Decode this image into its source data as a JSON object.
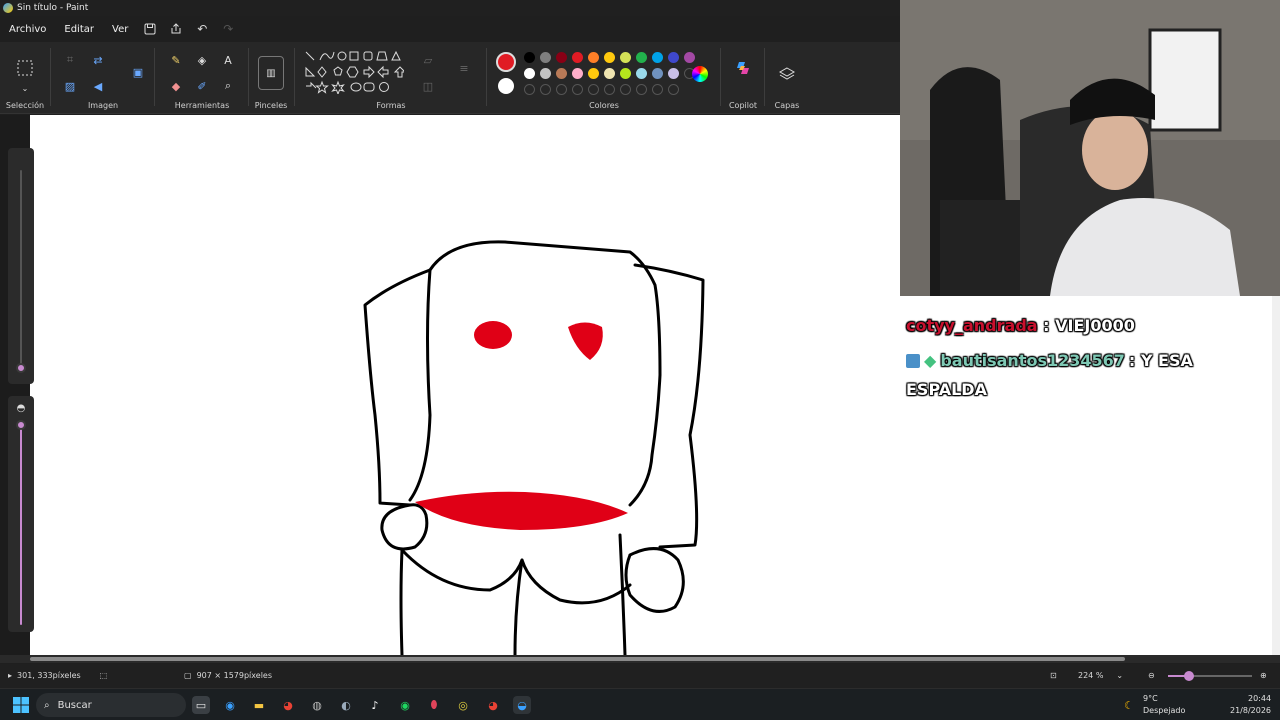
{
  "window": {
    "title": "Sin título - Paint"
  },
  "menu": {
    "file": "Archivo",
    "edit": "Editar",
    "view": "Ver"
  },
  "ribbon": {
    "groups": {
      "selection": "Selección",
      "image": "Imagen",
      "tools": "Herramientas",
      "brushes": "Pinceles",
      "shapes": "Formas",
      "colors": "Colores",
      "copilot": "Copilot",
      "layers": "Capas"
    },
    "text_tool_glyph": "A"
  },
  "palette": {
    "primary": "#e01b24",
    "secondary": "#ffffff",
    "row1": [
      "#000000",
      "#7f7f7f",
      "#880015",
      "#e01b24",
      "#ff7f27",
      "#ffc90e",
      "#d4e157",
      "#22b14c",
      "#00a2e8",
      "#3f48cc",
      "#a349a4"
    ],
    "row2": [
      "#ffffff",
      "#c3c3c3",
      "#b97a57",
      "#ffaec9",
      "#ffc90e",
      "#efe4b0",
      "#b5e61d",
      "#99d9ea",
      "#7092be",
      "#c8bfe7"
    ]
  },
  "status": {
    "cursor_position": "301, 333píxeles",
    "canvas_size": "907 × 1579píxeles",
    "zoom": "224 %"
  },
  "taskbar": {
    "search_placeholder": "Buscar",
    "weather_temp": "9°C",
    "weather_desc": "Despejado",
    "time": "20:44",
    "date": "21/8/2026"
  },
  "chat": {
    "messages": [
      {
        "user": "cotyy_andrada",
        "user_color": "#c8102e",
        "text": ": VIEJ0000"
      },
      {
        "user": "bautisantos1234567",
        "user_color": "#7ec8b4",
        "text": ": Y ESA"
      },
      {
        "user": "",
        "user_color": "#ffffff",
        "text": "ESPALDA"
      }
    ]
  },
  "colors": {
    "drawing_red": "#e00016",
    "slider_accent": "#c88ad0"
  }
}
